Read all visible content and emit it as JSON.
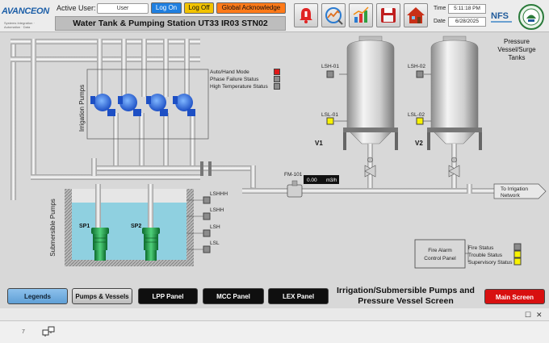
{
  "header": {
    "logo": "AVANCEON",
    "logo_tagline": "Systems Integration · Automation · Data",
    "active_user_label": "Active User:",
    "user_value": "User",
    "logon_label": "Log On",
    "logoff_label": "Log Off",
    "global_ack_label": "Global Acknowledge",
    "title": "Water Tank & Pumping Station UT33 IR03 STN02",
    "time_label": "Time",
    "time_value": "5:11:18 PM",
    "date_label": "Date",
    "date_value": "6/28/2025",
    "nfs_logo": "NFS",
    "nav_icons": [
      "alarm-bell-icon",
      "trend-gauge-icon",
      "bar-chart-icon",
      "save-icon",
      "home-icon"
    ]
  },
  "process": {
    "irrigation_pumps_label": "Irrigation Pumps",
    "status_items": [
      {
        "label": "Auto/Hand Mode",
        "color": "#e01818"
      },
      {
        "label": "Phase Failure Status",
        "color": "#8c8c8c"
      },
      {
        "label": "High Temperature Status",
        "color": "#8c8c8c"
      }
    ],
    "tanks_title_line1": "Pressure",
    "tanks_title_line2": "Vessel/Surge",
    "tanks_title_line3": "Tanks",
    "tank1": {
      "name": "V1",
      "lsh": "LSH-01",
      "lsl": "LSL-01",
      "lsh_color": "#8c8c8c",
      "lsl_color": "#f8f200"
    },
    "tank2": {
      "name": "V2",
      "lsh": "LSH-02",
      "lsl": "LSL-02",
      "lsh_color": "#8c8c8c",
      "lsl_color": "#f8f200"
    },
    "flow_meter_tag": "FM-101",
    "flow_value": "0.00",
    "flow_unit": "m3/h",
    "network_line1": "To Irrigation",
    "network_line2": "Network",
    "submersible_label": "Submersible Pumps",
    "sp1": "SP1",
    "sp2": "SP2",
    "levels": [
      {
        "label": "LSHHH",
        "color": "#8c8c8c"
      },
      {
        "label": "LSHH",
        "color": "#8c8c8c"
      },
      {
        "label": "LSH",
        "color": "#8c8c8c"
      },
      {
        "label": "LSL",
        "color": "#8c8c8c"
      }
    ],
    "fire_panel_line1": "Fire Alarm",
    "fire_panel_line2": "Control Panel",
    "fire_status": [
      {
        "label": "Fire Status",
        "color": "#8c8c8c"
      },
      {
        "label": "Trouble Status",
        "color": "#f8f200"
      },
      {
        "label": "Supervisory Status",
        "color": "#f8f200"
      }
    ]
  },
  "footer": {
    "legends": "Legends",
    "pumps_vessels": "Pumps & Vessels",
    "lpp": "LPP Panel",
    "mcc": "MCC Panel",
    "lex": "LEX Panel",
    "screen_title_line1": "Irrigation/Submersible Pumps and",
    "screen_title_line2": "Pressure Vessel Screen",
    "main_screen": "Main Screen"
  },
  "window_status": {
    "counter": "7"
  }
}
